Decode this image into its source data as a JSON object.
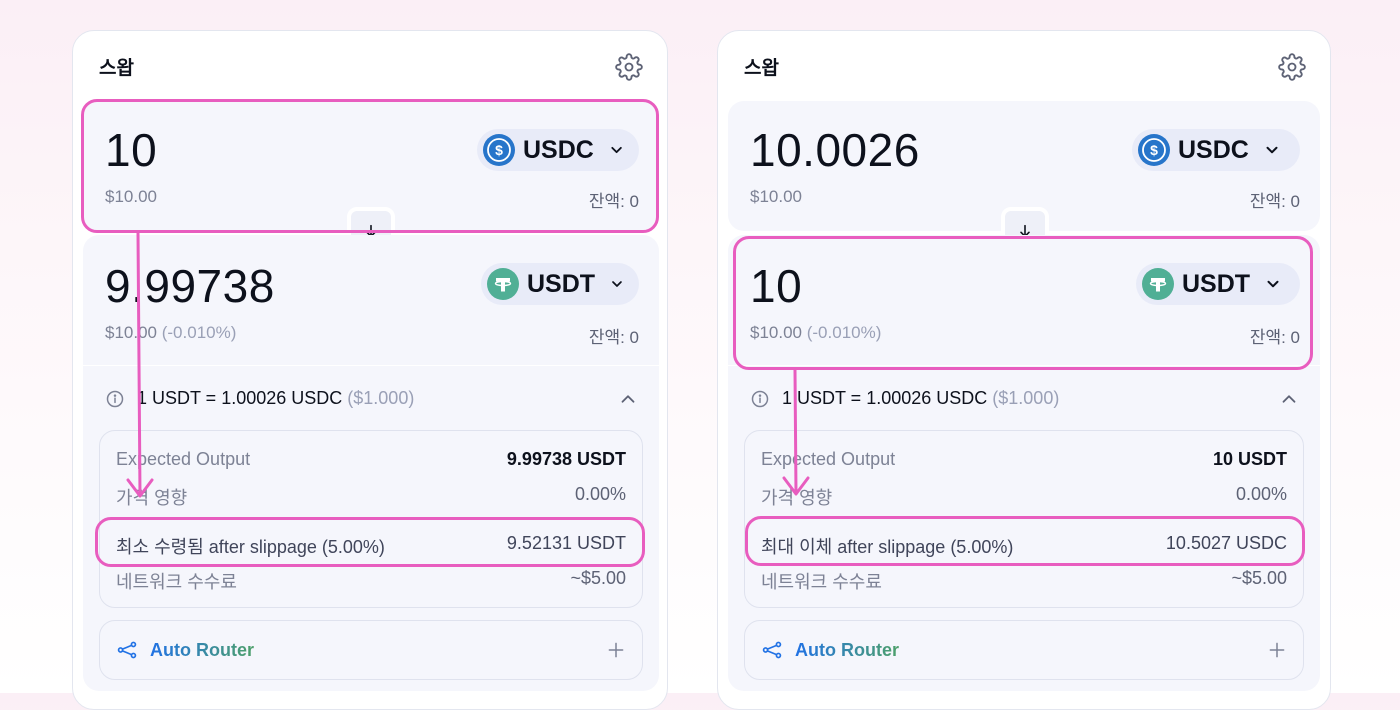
{
  "colors": {
    "highlight": "#e85dbf",
    "usdc": "#2775ca",
    "usdt": "#50af95"
  },
  "left": {
    "title": "스왑",
    "input": {
      "amount": "10",
      "usd": "$10.00",
      "balance": "잔액: 0",
      "token": "USDC"
    },
    "output": {
      "amount": "9.99738",
      "usd": "$10.00",
      "usd_change": "(-0.010%)",
      "balance": "잔액: 0",
      "token": "USDT"
    },
    "rate": {
      "text": "1 USDT = 1.00026 USDC",
      "usd": "($1.000)"
    },
    "details": [
      {
        "label": "Expected Output",
        "value": "9.99738 USDT"
      },
      {
        "label": "가격 영향",
        "value": "0.00%"
      },
      {
        "label": "최소 수령됨 after slippage (5.00%)",
        "value": "9.52131 USDT"
      },
      {
        "label": "네트워크 수수료",
        "value": "~$5.00"
      }
    ],
    "router_label": "Auto Router"
  },
  "right": {
    "title": "스왑",
    "input": {
      "amount": "10.0026",
      "usd": "$10.00",
      "balance": "잔액: 0",
      "token": "USDC"
    },
    "output": {
      "amount": "10",
      "usd": "$10.00",
      "usd_change": "(-0.010%)",
      "balance": "잔액: 0",
      "token": "USDT"
    },
    "rate": {
      "text": "1 USDT = 1.00026 USDC",
      "usd": "($1.000)"
    },
    "details": [
      {
        "label": "Expected Output",
        "value": "10 USDT"
      },
      {
        "label": "가격 영향",
        "value": "0.00%"
      },
      {
        "label": "최대 이체 after slippage (5.00%)",
        "value": "10.5027 USDC"
      },
      {
        "label": "네트워크 수수료",
        "value": "~$5.00"
      }
    ],
    "router_label": "Auto Router"
  }
}
